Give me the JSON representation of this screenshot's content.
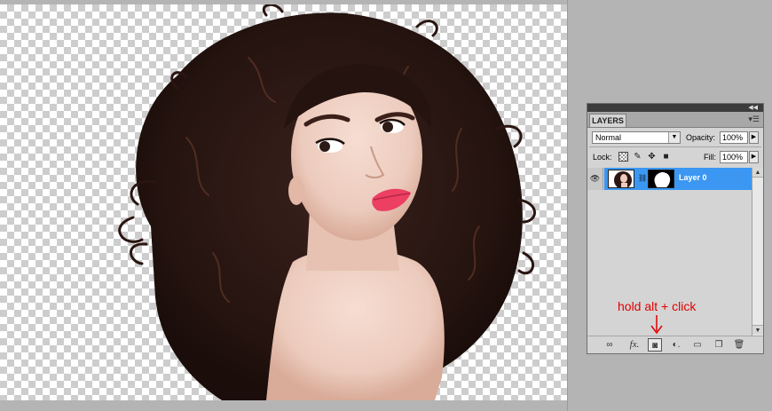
{
  "panel": {
    "tab_label": "LAYERS",
    "blend_mode": "Normal",
    "opacity_label": "Opacity:",
    "opacity_value": "100%",
    "lock_label": "Lock:",
    "fill_label": "Fill:",
    "fill_value": "100%",
    "layers": [
      {
        "name": "Layer 0",
        "visible": true,
        "selected": true,
        "has_mask": true
      }
    ],
    "bottom_icons": [
      "link-icon",
      "fx-icon",
      "add-mask-icon",
      "adjustment-icon",
      "group-folder-icon",
      "new-layer-icon",
      "trash-icon"
    ]
  },
  "annotation": {
    "text": "hold alt + click",
    "color": "#e00000"
  },
  "colors": {
    "selection": "#3b97f2",
    "panel_bg": "#d4d4d4",
    "workspace_bg": "#b4b4b4"
  }
}
